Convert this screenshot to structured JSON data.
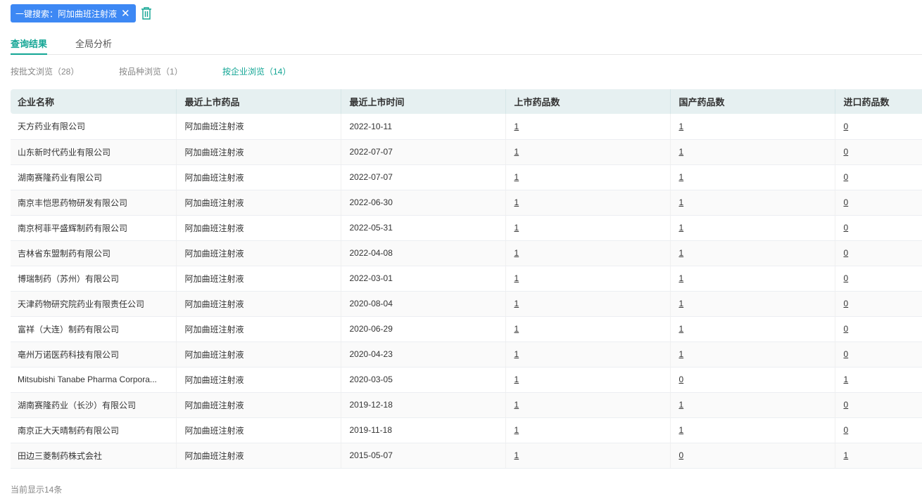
{
  "search_tag": {
    "label": "一键搜索：阿加曲班注射液"
  },
  "tabs": [
    {
      "label": "查询结果"
    },
    {
      "label": "全局分析"
    }
  ],
  "sub_tabs": [
    {
      "label": "按批文浏览（28）"
    },
    {
      "label": "按品种浏览（1）"
    },
    {
      "label": "按企业浏览（14）"
    }
  ],
  "table": {
    "headers": [
      "企业名称",
      "最近上市药品",
      "最近上市时间",
      "上市药品数",
      "国产药品数",
      "进口药品数"
    ],
    "rows": [
      [
        "天方药业有限公司",
        "阿加曲班注射液",
        "2022-10-11",
        "1",
        "1",
        "0"
      ],
      [
        "山东新时代药业有限公司",
        "阿加曲班注射液",
        "2022-07-07",
        "1",
        "1",
        "0"
      ],
      [
        "湖南赛隆药业有限公司",
        "阿加曲班注射液",
        "2022-07-07",
        "1",
        "1",
        "0"
      ],
      [
        "南京丰恺思药物研发有限公司",
        "阿加曲班注射液",
        "2022-06-30",
        "1",
        "1",
        "0"
      ],
      [
        "南京柯菲平盛辉制药有限公司",
        "阿加曲班注射液",
        "2022-05-31",
        "1",
        "1",
        "0"
      ],
      [
        "吉林省东盟制药有限公司",
        "阿加曲班注射液",
        "2022-04-08",
        "1",
        "1",
        "0"
      ],
      [
        "博瑞制药（苏州）有限公司",
        "阿加曲班注射液",
        "2022-03-01",
        "1",
        "1",
        "0"
      ],
      [
        "天津药物研究院药业有限责任公司",
        "阿加曲班注射液",
        "2020-08-04",
        "1",
        "1",
        "0"
      ],
      [
        "富祥（大连）制药有限公司",
        "阿加曲班注射液",
        "2020-06-29",
        "1",
        "1",
        "0"
      ],
      [
        "亳州万诺医药科技有限公司",
        "阿加曲班注射液",
        "2020-04-23",
        "1",
        "1",
        "0"
      ],
      [
        "Mitsubishi Tanabe Pharma Corpora...",
        "阿加曲班注射液",
        "2020-03-05",
        "1",
        "0",
        "1"
      ],
      [
        "湖南赛隆药业（长沙）有限公司",
        "阿加曲班注射液",
        "2019-12-18",
        "1",
        "1",
        "0"
      ],
      [
        "南京正大天晴制药有限公司",
        "阿加曲班注射液",
        "2019-11-18",
        "1",
        "1",
        "0"
      ],
      [
        "田边三菱制药株式会社",
        "阿加曲班注射液",
        "2015-05-07",
        "1",
        "0",
        "1"
      ]
    ]
  },
  "footer": "当前显示14条"
}
